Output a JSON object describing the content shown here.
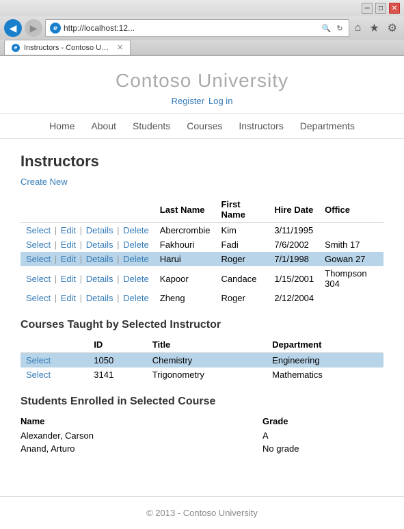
{
  "browser": {
    "address": "http://localhost:12...",
    "tab_label": "Instructors - Contoso Unive...",
    "back_icon": "◀",
    "forward_icon": "▶",
    "minimize_label": "─",
    "maximize_label": "□",
    "close_label": "✕",
    "refresh_icon": "↻",
    "search_icon": "🔍",
    "home_icon": "⌂",
    "fav_icon": "★",
    "settings_icon": "⚙"
  },
  "site": {
    "title": "Contoso University",
    "auth": {
      "register": "Register",
      "login": "Log in"
    },
    "nav": [
      "Home",
      "About",
      "Students",
      "Courses",
      "Instructors",
      "Departments"
    ]
  },
  "page": {
    "heading": "Instructors",
    "create_new": "Create New"
  },
  "instructors_table": {
    "columns": [
      "",
      "Last Name",
      "First Name",
      "Hire Date",
      "Office"
    ],
    "rows": [
      {
        "actions": [
          "Select",
          "Edit",
          "Details",
          "Delete"
        ],
        "last_name": "Abercrombie",
        "first_name": "Kim",
        "hire_date": "3/11/1995",
        "office": "",
        "selected": false
      },
      {
        "actions": [
          "Select",
          "Edit",
          "Details",
          "Delete"
        ],
        "last_name": "Fakhouri",
        "first_name": "Fadi",
        "hire_date": "7/6/2002",
        "office": "Smith 17",
        "selected": false
      },
      {
        "actions": [
          "Select",
          "Edit",
          "Details",
          "Delete"
        ],
        "last_name": "Harui",
        "first_name": "Roger",
        "hire_date": "7/1/1998",
        "office": "Gowan 27",
        "selected": true
      },
      {
        "actions": [
          "Select",
          "Edit",
          "Details",
          "Delete"
        ],
        "last_name": "Kapoor",
        "first_name": "Candace",
        "hire_date": "1/15/2001",
        "office": "Thompson 304",
        "selected": false
      },
      {
        "actions": [
          "Select",
          "Edit",
          "Details",
          "Delete"
        ],
        "last_name": "Zheng",
        "first_name": "Roger",
        "hire_date": "2/12/2004",
        "office": "",
        "selected": false
      }
    ]
  },
  "courses_section": {
    "heading": "Courses Taught by Selected Instructor",
    "columns": [
      "",
      "ID",
      "Title",
      "Department"
    ],
    "rows": [
      {
        "select": "Select",
        "id": "1050",
        "title": "Chemistry",
        "department": "Engineering",
        "selected": true
      },
      {
        "select": "Select",
        "id": "3141",
        "title": "Trigonometry",
        "department": "Mathematics",
        "selected": false
      }
    ]
  },
  "students_section": {
    "heading": "Students Enrolled in Selected Course",
    "columns": [
      "Name",
      "Grade"
    ],
    "rows": [
      {
        "name": "Alexander, Carson",
        "grade": "A"
      },
      {
        "name": "Anand, Arturo",
        "grade": "No grade"
      }
    ]
  },
  "footer": {
    "text": "© 2013 - Contoso University"
  }
}
